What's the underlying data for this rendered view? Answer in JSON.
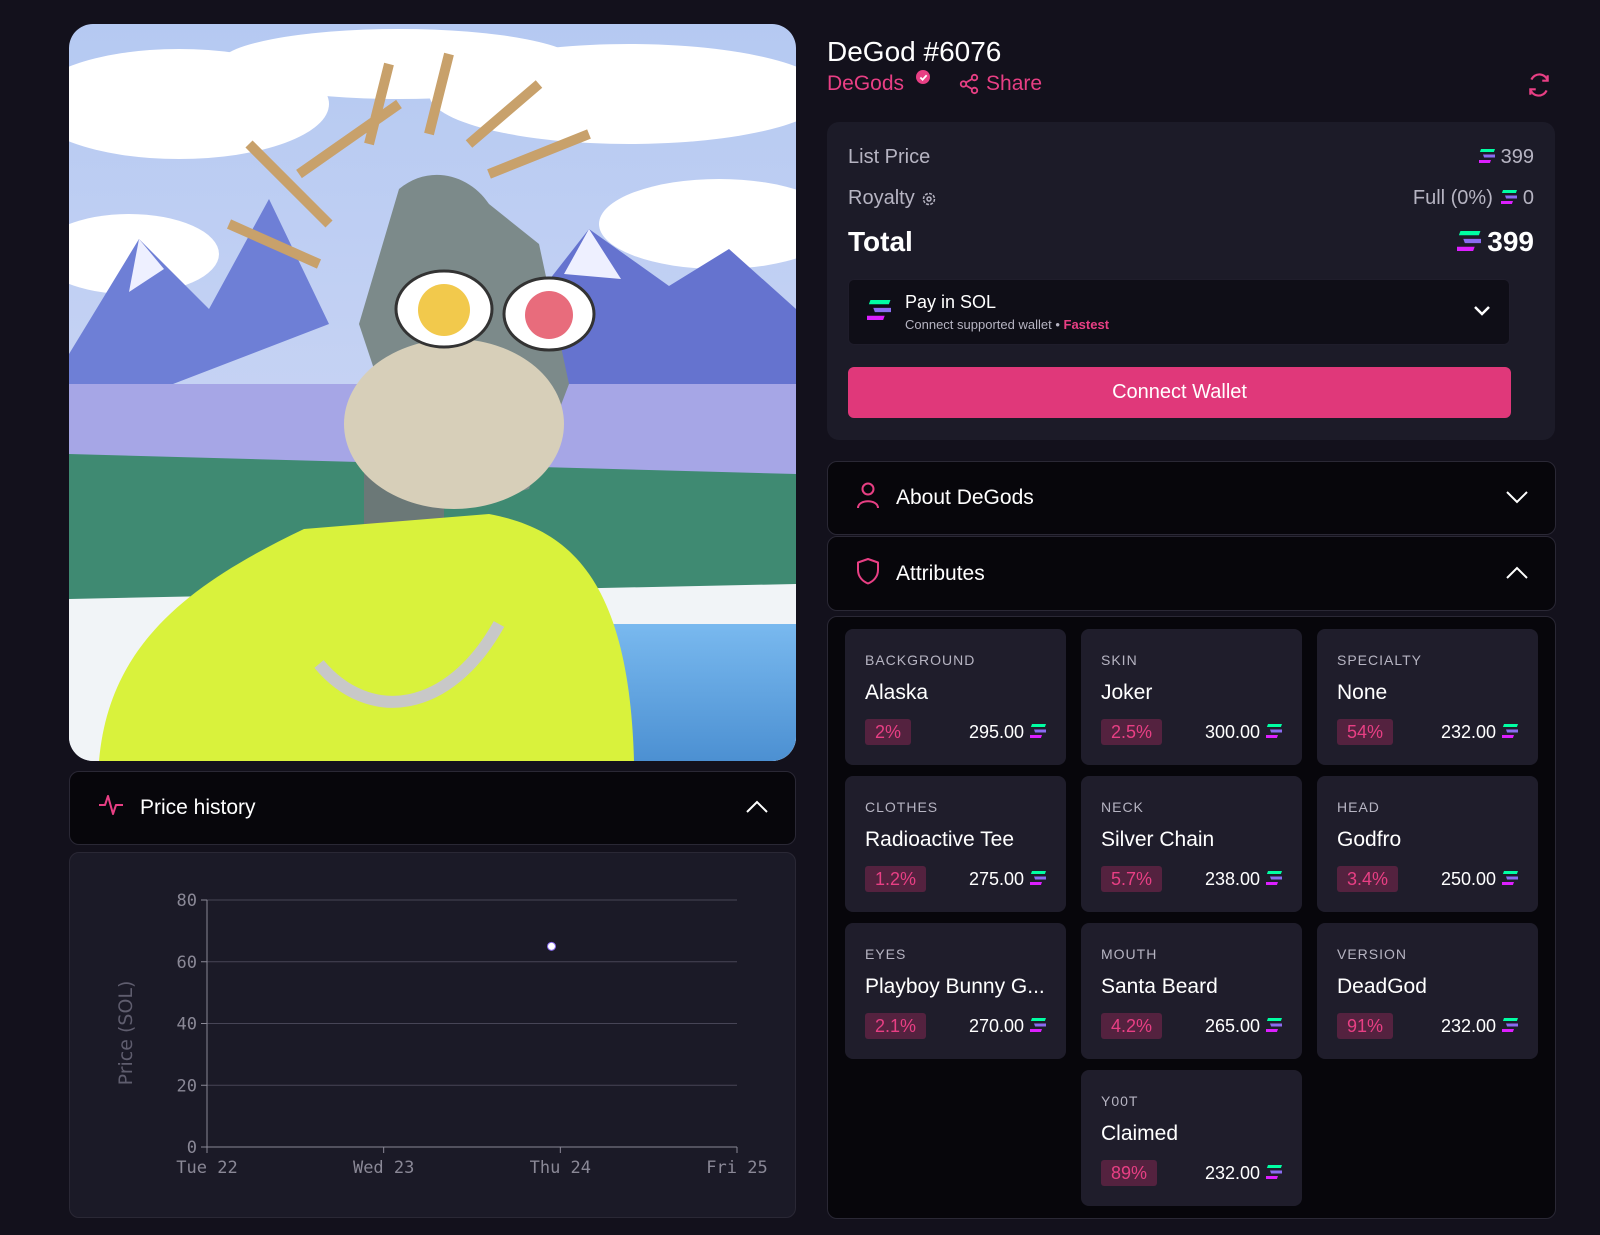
{
  "nft": {
    "title": "DeGod #6076",
    "collection": "DeGods",
    "share_label": "Share"
  },
  "price_card": {
    "list_price_label": "List Price",
    "list_price_value": "399",
    "royalty_label": "Royalty",
    "royalty_option": "Full (0%)",
    "royalty_value": "0",
    "total_label": "Total",
    "total_value": "399",
    "pay_title": "Pay in SOL",
    "pay_sub": "Connect supported wallet",
    "pay_sub_sep": "•",
    "pay_badge": "Fastest",
    "connect_label": "Connect Wallet"
  },
  "accordions": {
    "about_label": "About DeGods",
    "attributes_label": "Attributes",
    "price_history_label": "Price history"
  },
  "attributes": [
    {
      "type": "BACKGROUND",
      "value": "Alaska",
      "pct": "2%",
      "price": "295.00"
    },
    {
      "type": "SKIN",
      "value": "Joker",
      "pct": "2.5%",
      "price": "300.00"
    },
    {
      "type": "SPECIALTY",
      "value": "None",
      "pct": "54%",
      "price": "232.00"
    },
    {
      "type": "CLOTHES",
      "value": "Radioactive Tee",
      "pct": "1.2%",
      "price": "275.00"
    },
    {
      "type": "NECK",
      "value": "Silver Chain",
      "pct": "5.7%",
      "price": "238.00"
    },
    {
      "type": "HEAD",
      "value": "Godfro",
      "pct": "3.4%",
      "price": "250.00"
    },
    {
      "type": "EYES",
      "value": "Playboy Bunny G...",
      "pct": "2.1%",
      "price": "270.00"
    },
    {
      "type": "MOUTH",
      "value": "Santa Beard",
      "pct": "4.2%",
      "price": "265.00"
    },
    {
      "type": "VERSION",
      "value": "DeadGod",
      "pct": "91%",
      "price": "232.00"
    },
    {
      "type": "Y00T",
      "value": "Claimed",
      "pct": "89%",
      "price": "232.00"
    }
  ],
  "colors": {
    "accent": "#e83f84",
    "background": "#13111c",
    "card": "#1c1b28",
    "sol_top": "#00ffa3",
    "sol_bottom": "#dc1fff"
  },
  "chart_data": {
    "type": "scatter",
    "ylabel": "Price (SOL)",
    "xlabel": "",
    "x_ticks": [
      "Tue 22",
      "Wed 23",
      "Thu 24",
      "Fri 25"
    ],
    "y_ticks": [
      0,
      20,
      40,
      60,
      80
    ],
    "ylim": [
      0,
      80
    ],
    "xlim": [
      0,
      3
    ],
    "points": [
      {
        "x": 1.95,
        "y": 65
      }
    ],
    "grid": true
  }
}
